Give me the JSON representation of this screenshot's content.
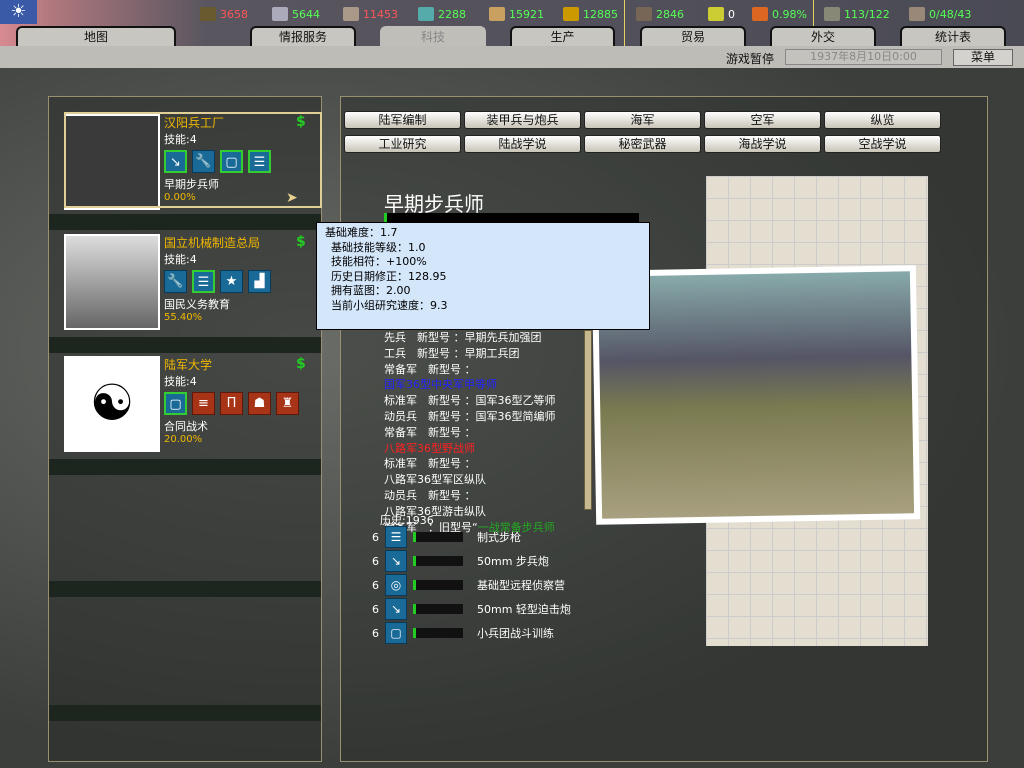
{
  "topbar": {
    "resources": [
      {
        "icon": "energy-icon",
        "value": "3658",
        "color": "#ff5555"
      },
      {
        "icon": "metal-icon",
        "value": "5644",
        "color": "#55ff55"
      },
      {
        "icon": "rare-materials-icon",
        "value": "11453",
        "color": "#ff5555"
      },
      {
        "icon": "oil-icon",
        "value": "2288",
        "color": "#55ff55"
      },
      {
        "icon": "supplies-icon",
        "value": "15921",
        "color": "#55ff55"
      },
      {
        "icon": "money-icon",
        "value": "12885",
        "color": "#55ff55"
      },
      {
        "icon": "manpower-icon",
        "value": "2846",
        "color": "#55ff55"
      },
      {
        "icon": "nuclear-icon",
        "value": "0",
        "color": "#ffffff"
      },
      {
        "icon": "dissent-icon",
        "value": "0.98%",
        "color": "#55ff55"
      },
      {
        "icon": "transport-icon",
        "value": "113/122",
        "color": "#55ff55"
      },
      {
        "icon": "convoy-icon",
        "value": "0/48/43",
        "color": "#55ff55"
      }
    ],
    "tabs": [
      "地图",
      "情报服务",
      "科技",
      "生产",
      "贸易",
      "外交",
      "统计表"
    ],
    "active_tab": "科技"
  },
  "status": {
    "pause": "游戏暂停",
    "date": "1937年8月10日0:00",
    "menu": "菜单"
  },
  "teams": [
    {
      "name": "汉阳兵工厂",
      "skill": "技能:4",
      "icons": [
        "artillery-icon",
        "wrench-icon",
        "book-icon",
        "rifle-doc-icon"
      ],
      "project": "早期步兵师",
      "progress": "0.00%",
      "progress_value": 0.0
    },
    {
      "name": "国立机械制造总局",
      "skill": "技能:4",
      "icons": [
        "wrench-icon",
        "rifle-doc-icon",
        "star-icon",
        "factory-icon"
      ],
      "project": "国民义务教育",
      "progress": "55.40%",
      "progress_value": 55.4
    },
    {
      "name": "陆军大学",
      "skill": "技能:4",
      "icons": [
        "book-icon",
        "tactics-icon",
        "command-icon",
        "infantry-icon",
        "officer-icon"
      ],
      "project": "合同战术",
      "progress": "20.00%",
      "progress_value": 20.0
    }
  ],
  "categories_row1": [
    "陆军编制",
    "装甲兵与炮兵",
    "海军",
    "空军",
    "纵览"
  ],
  "categories_row2": [
    "工业研究",
    "陆战学说",
    "秘密武器",
    "海战学说",
    "空战学说"
  ],
  "tech": {
    "title": "早期步兵师",
    "history": "历史:1936",
    "lines": [
      {
        "t": "先兵　新型号 ：早期先兵加强团",
        "c": ""
      },
      {
        "t": "工兵　新型号 ：早期工兵团",
        "c": ""
      },
      {
        "t": "常备军　新型号 ：",
        "c": ""
      },
      {
        "t": "国军36型中央军甲等师",
        "c": "b"
      },
      {
        "t": "标准军　新型号 ：国军36型乙等师",
        "c": ""
      },
      {
        "t": "动员兵　新型号 ：国军36型简编师",
        "c": ""
      },
      {
        "t": "常备军　新型号 ：",
        "c": ""
      },
      {
        "t": "八路军36型野战师",
        "c": "rd"
      },
      {
        "t": "标准军　新型号 ：",
        "c": ""
      },
      {
        "t": "八路军36型军区纵队",
        "c": ""
      },
      {
        "t": "动员兵　新型号 ：",
        "c": ""
      },
      {
        "t": "八路军36型游击纵队",
        "c": ""
      }
    ],
    "last_line_prefix": "常备军　：旧型号“",
    "last_line_green": "一战常备步兵师",
    "requirements": [
      {
        "level": "6",
        "icon": "rifle-doc-icon",
        "name": "制式步枪"
      },
      {
        "level": "6",
        "icon": "artillery-icon",
        "name": "50mm 步兵炮"
      },
      {
        "level": "6",
        "icon": "lightbulb-icon",
        "name": "基础型远程侦察营"
      },
      {
        "level": "6",
        "icon": "artillery-icon",
        "name": "50mm 轻型迫击炮"
      },
      {
        "level": "6",
        "icon": "book-icon",
        "name": "小兵团战斗训练"
      }
    ]
  },
  "tooltip": [
    "基础难度：1.7",
    "基础技能等级：1.0",
    "技能相符：+100%",
    "历史日期修正：128.95",
    "拥有蓝图：2.00",
    "当前小组研究速度：9.3"
  ]
}
